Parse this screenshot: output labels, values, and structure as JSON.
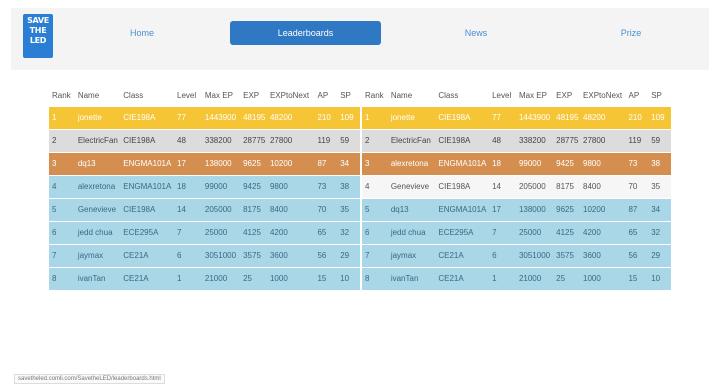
{
  "logo": {
    "lines": [
      "SAVE",
      "THE",
      "LED"
    ]
  },
  "nav": {
    "home": "Home",
    "leaderboards": "Leaderboards",
    "news": "News",
    "prize": "Prize"
  },
  "colors": {
    "gold": "#f6c535",
    "silver": "#dcdcdc",
    "bronze": "#d48f50",
    "blue": "#a9d7e8",
    "active_nav": "#2f78c4"
  },
  "table_left": {
    "headers": [
      "Rank",
      "Name",
      "Class",
      "Level",
      "Max EP",
      "EXP",
      "EXPtoNext",
      "AP",
      "SP"
    ],
    "rows": [
      [
        "1",
        "jonette",
        "CIE198A",
        "77",
        "1443900",
        "48195",
        "48200",
        "210",
        "109"
      ],
      [
        "2",
        "ElectricFan",
        "CIE198A",
        "48",
        "338200",
        "28775",
        "27800",
        "119",
        "59"
      ],
      [
        "3",
        "dq13",
        "ENGMA101A",
        "17",
        "138000",
        "9625",
        "10200",
        "87",
        "34"
      ],
      [
        "4",
        "alexretona",
        "ENGMA101A",
        "18",
        "99000",
        "9425",
        "9800",
        "73",
        "38"
      ],
      [
        "5",
        "Genevieve",
        "CIE198A",
        "14",
        "205000",
        "8175",
        "8400",
        "70",
        "35"
      ],
      [
        "6",
        "jedd chua",
        "ECE295A",
        "7",
        "25000",
        "4125",
        "4200",
        "65",
        "32"
      ],
      [
        "7",
        "jaymax",
        "CE21A",
        "6",
        "3051000",
        "3575",
        "3600",
        "56",
        "29"
      ],
      [
        "8",
        "ivanTan",
        "CE21A",
        "1",
        "21000",
        "25",
        "1000",
        "15",
        "10"
      ]
    ]
  },
  "table_right": {
    "headers": [
      "Rank",
      "Name",
      "Class",
      "Level",
      "Max EP",
      "EXP",
      "EXPtoNext",
      "AP",
      "SP"
    ],
    "rows": [
      [
        "1",
        "jonette",
        "CIE198A",
        "77",
        "1443900",
        "48195",
        "48200",
        "210",
        "109"
      ],
      [
        "2",
        "ElectricFan",
        "CIE198A",
        "48",
        "338200",
        "28775",
        "27800",
        "119",
        "59"
      ],
      [
        "3",
        "alexretona",
        "ENGMA101A",
        "18",
        "99000",
        "9425",
        "9800",
        "73",
        "38"
      ],
      [
        "4",
        "Genevieve",
        "CIE198A",
        "14",
        "205000",
        "8175",
        "8400",
        "70",
        "35"
      ],
      [
        "5",
        "dq13",
        "ENGMA101A",
        "17",
        "138000",
        "9625",
        "10200",
        "87",
        "34"
      ],
      [
        "6",
        "jedd chua",
        "ECE295A",
        "7",
        "25000",
        "4125",
        "4200",
        "65",
        "32"
      ],
      [
        "7",
        "jaymax",
        "CE21A",
        "6",
        "3051000",
        "3575",
        "3600",
        "56",
        "29"
      ],
      [
        "8",
        "ivanTan",
        "CE21A",
        "1",
        "21000",
        "25",
        "1000",
        "15",
        "10"
      ]
    ]
  },
  "status": {
    "url": "savetheled.comli.com/SavetheLED/leaderboards.html"
  }
}
